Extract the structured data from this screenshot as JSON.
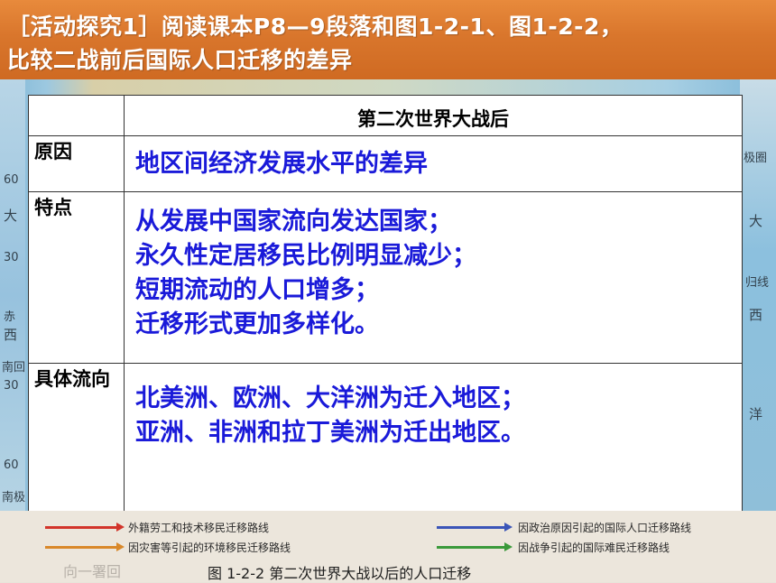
{
  "header": {
    "line1": "［活动探究1］阅读课本P8—9段落和图1-2-1、图1-2-2，",
    "line2": "比较二战前后国际人口迁移的差异"
  },
  "table": {
    "column_header": "第二次世界大战后",
    "rows": [
      {
        "label": "原因",
        "content": [
          "地区间经济发展水平的差异"
        ]
      },
      {
        "label": "特点",
        "content": [
          "从发展中国家流向发达国家；",
          "永久性定居移民比例明显减少；",
          "短期流动的人口增多；",
          "迁移形式更加多样化。"
        ]
      },
      {
        "label": "具体流向",
        "content": [
          "北美洲、欧洲、大洋洲为迁入地区；",
          "亚洲、非洲和拉丁美洲为迁出地区。"
        ]
      }
    ]
  },
  "map_labels": {
    "left": [
      "60",
      "大",
      "30",
      "赤",
      "西",
      "南回",
      "30",
      "60",
      "南极"
    ],
    "right": [
      "极圈",
      "大",
      "归线",
      "西",
      "洋"
    ]
  },
  "legend": {
    "items": [
      {
        "text": "外籍劳工和技术移民迁移路线",
        "color": "#d2342a"
      },
      {
        "text": "因灾害等引起的环境移民迁移路线",
        "color": "#d9882a"
      },
      {
        "text": "因政治原因引起的国际人口迁移路线",
        "color": "#3b55b8"
      },
      {
        "text": "因战争引起的国际难民迁移路线",
        "color": "#3b9a3b"
      }
    ],
    "faint_text": "向一署回",
    "caption": "图 1-2-2   第二次世界大战以后的人口迁移"
  }
}
